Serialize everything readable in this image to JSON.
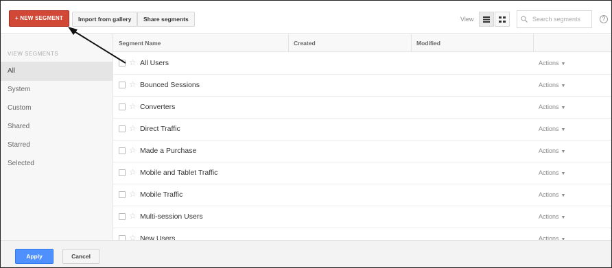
{
  "toolbar": {
    "new_segment_label": "+ NEW SEGMENT",
    "import_label": "Import from gallery",
    "share_label": "Share segments",
    "view_label": "View",
    "search_placeholder": "Search segments",
    "help_icon": "help-icon"
  },
  "sidebar": {
    "title": "VIEW SEGMENTS",
    "items": [
      {
        "label": "All",
        "active": true
      },
      {
        "label": "System"
      },
      {
        "label": "Custom"
      },
      {
        "label": "Shared"
      },
      {
        "label": "Starred"
      },
      {
        "label": "Selected"
      }
    ]
  },
  "table": {
    "headers": [
      "Segment Name",
      "Created",
      "Modified"
    ],
    "action_label": "Actions",
    "rows": [
      {
        "name": "All Users"
      },
      {
        "name": "Bounced Sessions"
      },
      {
        "name": "Converters"
      },
      {
        "name": "Direct Traffic"
      },
      {
        "name": "Made a Purchase"
      },
      {
        "name": "Mobile and Tablet Traffic"
      },
      {
        "name": "Mobile Traffic"
      },
      {
        "name": "Multi-session Users"
      },
      {
        "name": "New Users"
      }
    ]
  },
  "footer": {
    "apply_label": "Apply",
    "cancel_label": "Cancel"
  },
  "colors": {
    "new_segment": "#d14836",
    "apply": "#4d90fe"
  }
}
